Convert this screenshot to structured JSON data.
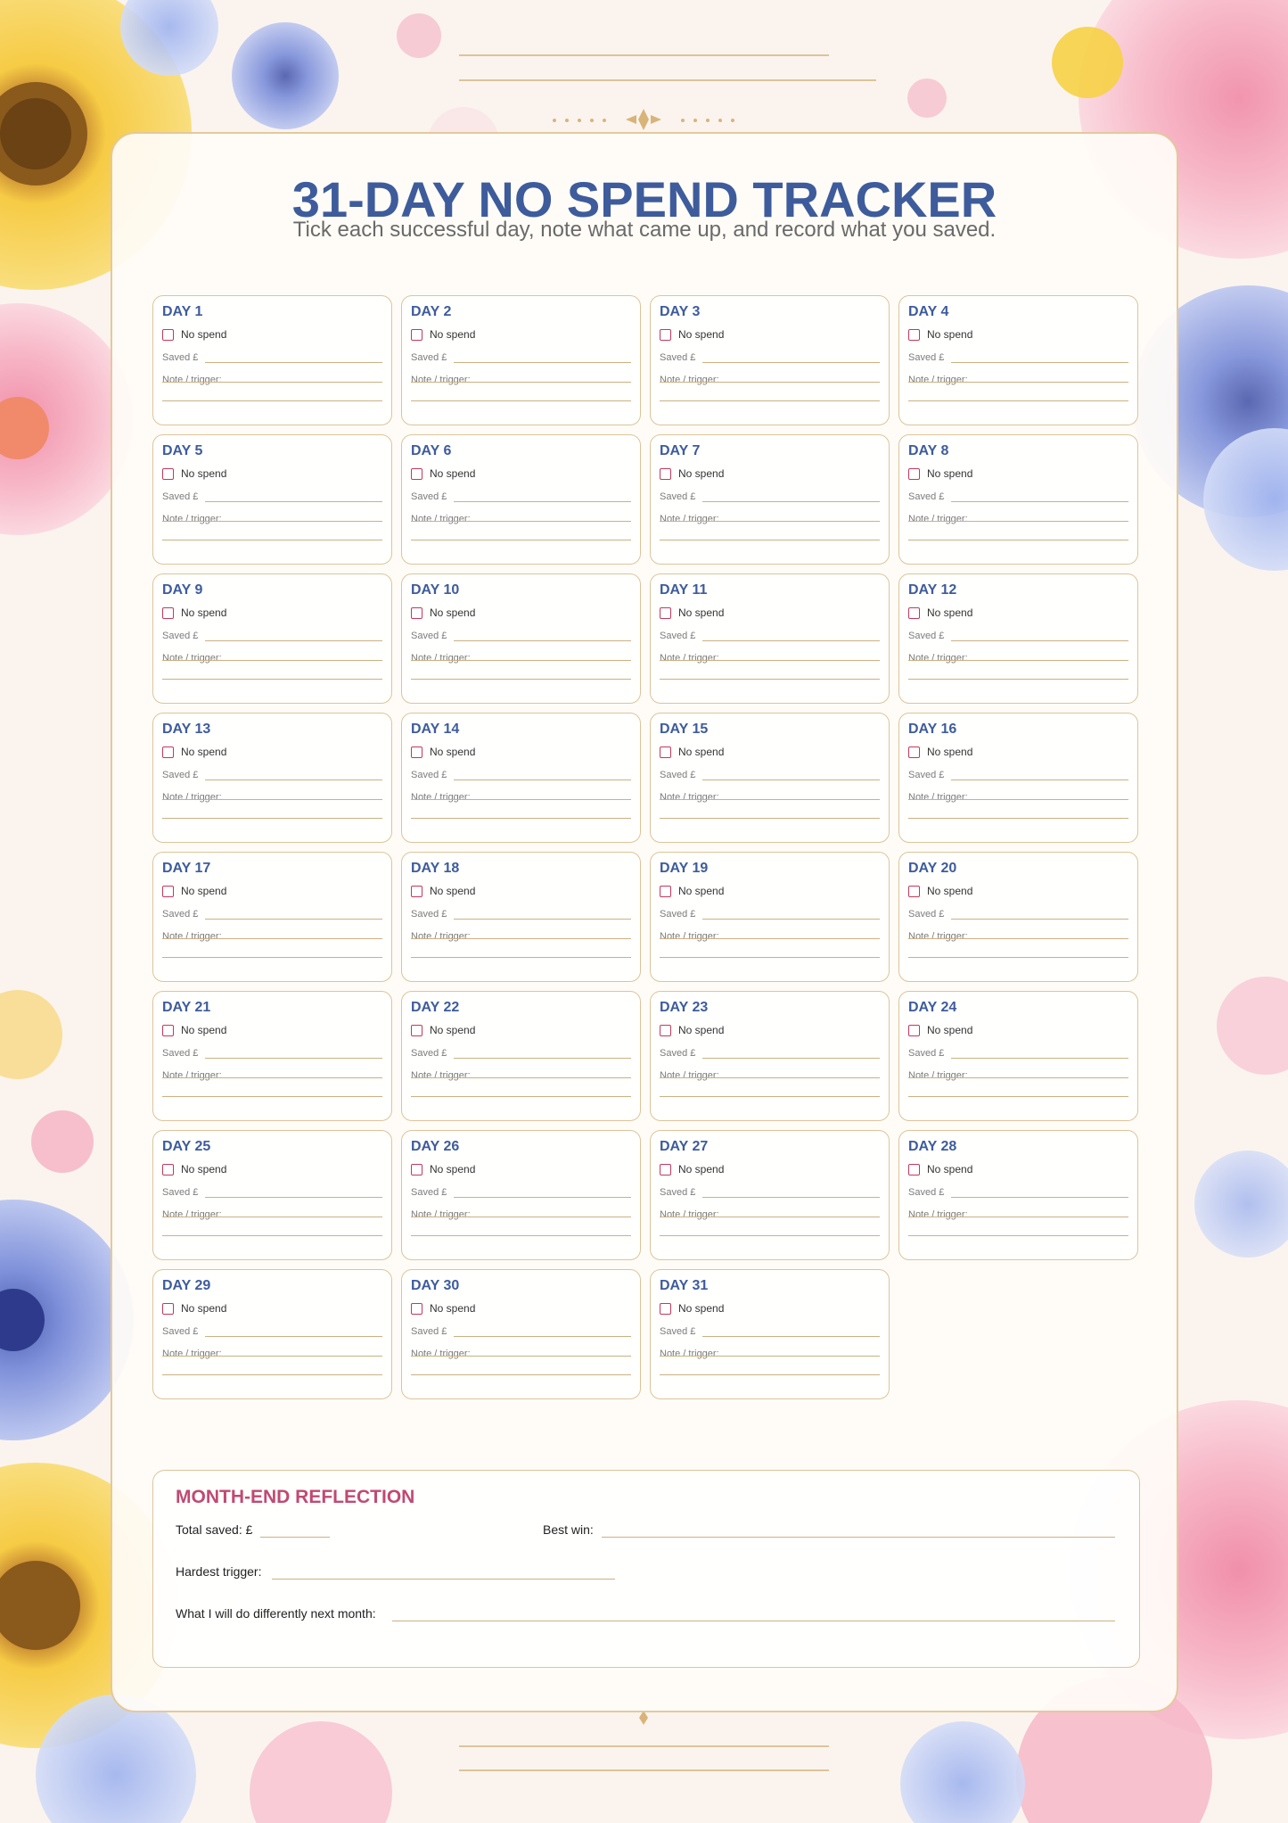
{
  "header": {
    "title": "31-DAY NO SPEND TRACKER",
    "subtitle": "Tick each successful day, note what came up, and record what you saved."
  },
  "day_card": {
    "checkbox_label": "No spend",
    "saved_label": "Saved £",
    "note_label": "Note / trigger:"
  },
  "days": [
    {
      "label": "DAY 1"
    },
    {
      "label": "DAY 2"
    },
    {
      "label": "DAY 3"
    },
    {
      "label": "DAY 4"
    },
    {
      "label": "DAY 5"
    },
    {
      "label": "DAY 6"
    },
    {
      "label": "DAY 7"
    },
    {
      "label": "DAY 8"
    },
    {
      "label": "DAY 9"
    },
    {
      "label": "DAY 10"
    },
    {
      "label": "DAY 11"
    },
    {
      "label": "DAY 12"
    },
    {
      "label": "DAY 13"
    },
    {
      "label": "DAY 14"
    },
    {
      "label": "DAY 15"
    },
    {
      "label": "DAY 16"
    },
    {
      "label": "DAY 17"
    },
    {
      "label": "DAY 18"
    },
    {
      "label": "DAY 19"
    },
    {
      "label": "DAY 20"
    },
    {
      "label": "DAY 21"
    },
    {
      "label": "DAY 22"
    },
    {
      "label": "DAY 23"
    },
    {
      "label": "DAY 24"
    },
    {
      "label": "DAY 25"
    },
    {
      "label": "DAY 26"
    },
    {
      "label": "DAY 27"
    },
    {
      "label": "DAY 28"
    },
    {
      "label": "DAY 29"
    },
    {
      "label": "DAY 30"
    },
    {
      "label": "DAY 31"
    }
  ],
  "reflection": {
    "title": "MONTH-END REFLECTION",
    "total_saved_label": "Total saved: £",
    "best_win_label": "Best win:",
    "hardest_trigger_label": "Hardest trigger:",
    "next_month_label": "What I will do differently next month:"
  },
  "colors": {
    "title_blue": "#3e5c9c",
    "reflection_pink": "#c04a72",
    "checkbox_pink": "#c2385f",
    "gold_line": "#cdb083",
    "card_border": "#dcc49a"
  }
}
